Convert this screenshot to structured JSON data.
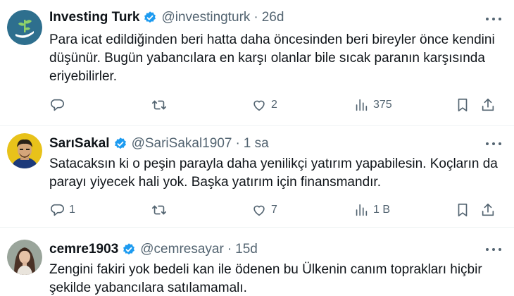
{
  "colors": {
    "accent": "#1d9bf0",
    "text": "#0f1419",
    "muted": "#536471",
    "divider": "#eff3f4"
  },
  "tweets": [
    {
      "name": "Investing Turk",
      "handle": "@investingturk",
      "dot": "·",
      "time": "26d",
      "lines": [
        "Para icat edildiğinden beri hatta daha öncesinden beri bireyler önce kendini",
        "düşünür. Bugün yabancılara en karşı olanlar bile sıcak paranın karşısında",
        "eriyebilirler."
      ],
      "replies": "",
      "retweets": "",
      "likes": "2",
      "views": "375"
    },
    {
      "name": "SarıSakal",
      "handle": "@SariSakal1907",
      "dot": "·",
      "time": "1 sa",
      "lines": [
        "Satacaksın ki o peşin parayla daha yenilikçi yatırım yapabilesin. Koçların da",
        "parayı yiyecek hali yok. Başka yatırım için finansmandır."
      ],
      "replies": "1",
      "retweets": "",
      "likes": "7",
      "views": "1 B"
    },
    {
      "name": "cemre1903",
      "handle": "@cemresayar",
      "dot": "·",
      "time": "15d",
      "lines": [
        "Zengini fakiri yok bedeli kan ile ödenen bu Ülkenin canım toprakları hiçbir",
        "şekilde yabancılara satılamamalı."
      ]
    }
  ]
}
